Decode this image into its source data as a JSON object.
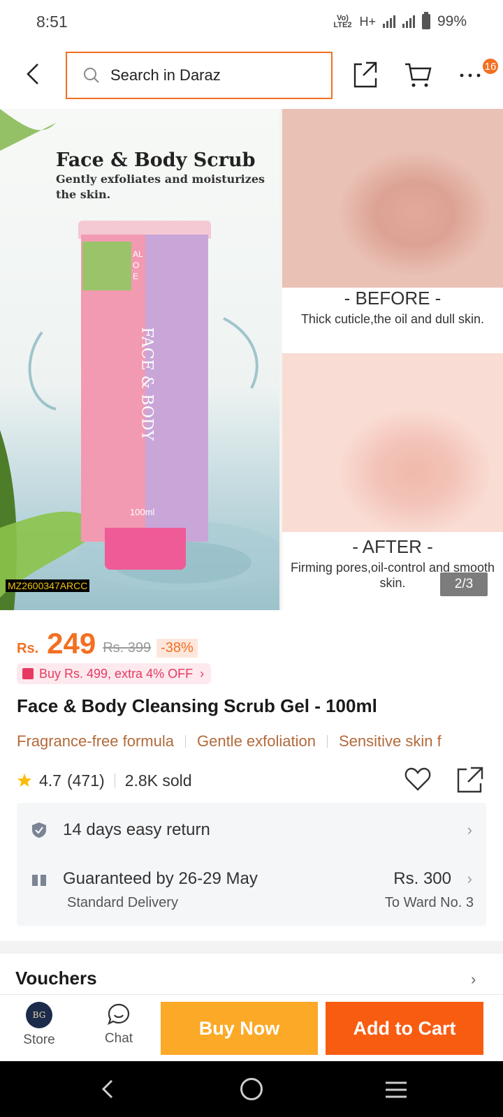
{
  "status_bar": {
    "time": "8:51",
    "network_small": "Vo) LTE2",
    "network_type": "H+",
    "battery": "99%"
  },
  "header": {
    "search_placeholder": "Search in Daraz",
    "cart_badge": "16"
  },
  "hero": {
    "title": "Face & Body Scrub",
    "subtitle": "Gently exfoliates and moisturizes the skin.",
    "before_label": "- BEFORE -",
    "before_desc": "Thick cuticle,the oil and dull skin.",
    "after_label": "- AFTER -",
    "after_desc": "Firming pores,oil-control and smooth skin.",
    "watermark": "MZ2600347ARCC",
    "page_indicator": "2/3",
    "tube_side_text": "ALOE",
    "tube_main_text": "FACE & BODY",
    "tube_volume": "100ml"
  },
  "price": {
    "currency": "Rs.",
    "current": "249",
    "original": "Rs. 399",
    "discount": "-38%"
  },
  "promo": {
    "text": "Buy Rs. 499, extra 4% OFF"
  },
  "product": {
    "title": "Face & Body Cleansing Scrub Gel - 100ml"
  },
  "tags": [
    "Fragrance-free formula",
    "Gentle exfoliation",
    "Sensitive skin f"
  ],
  "rating": {
    "score": "4.7",
    "count": "(471)",
    "sold": "2.8K sold"
  },
  "info": {
    "return_text": "14 days easy return",
    "delivery_text": "Guaranteed by 26-29 May",
    "delivery_type": "Standard Delivery",
    "shipping_price": "Rs. 300",
    "shipping_to": "To Ward No. 3"
  },
  "vouchers": {
    "label": "Vouchers"
  },
  "bottom_bar": {
    "store_label": "Store",
    "store_logo": "BG",
    "chat_label": "Chat",
    "buy_now": "Buy Now",
    "add_to_cart": "Add to Cart"
  },
  "colors": {
    "accent": "#f36f21",
    "buy_now": "#fba927",
    "add_to_cart": "#f85c11",
    "promo": "#e63a62"
  }
}
